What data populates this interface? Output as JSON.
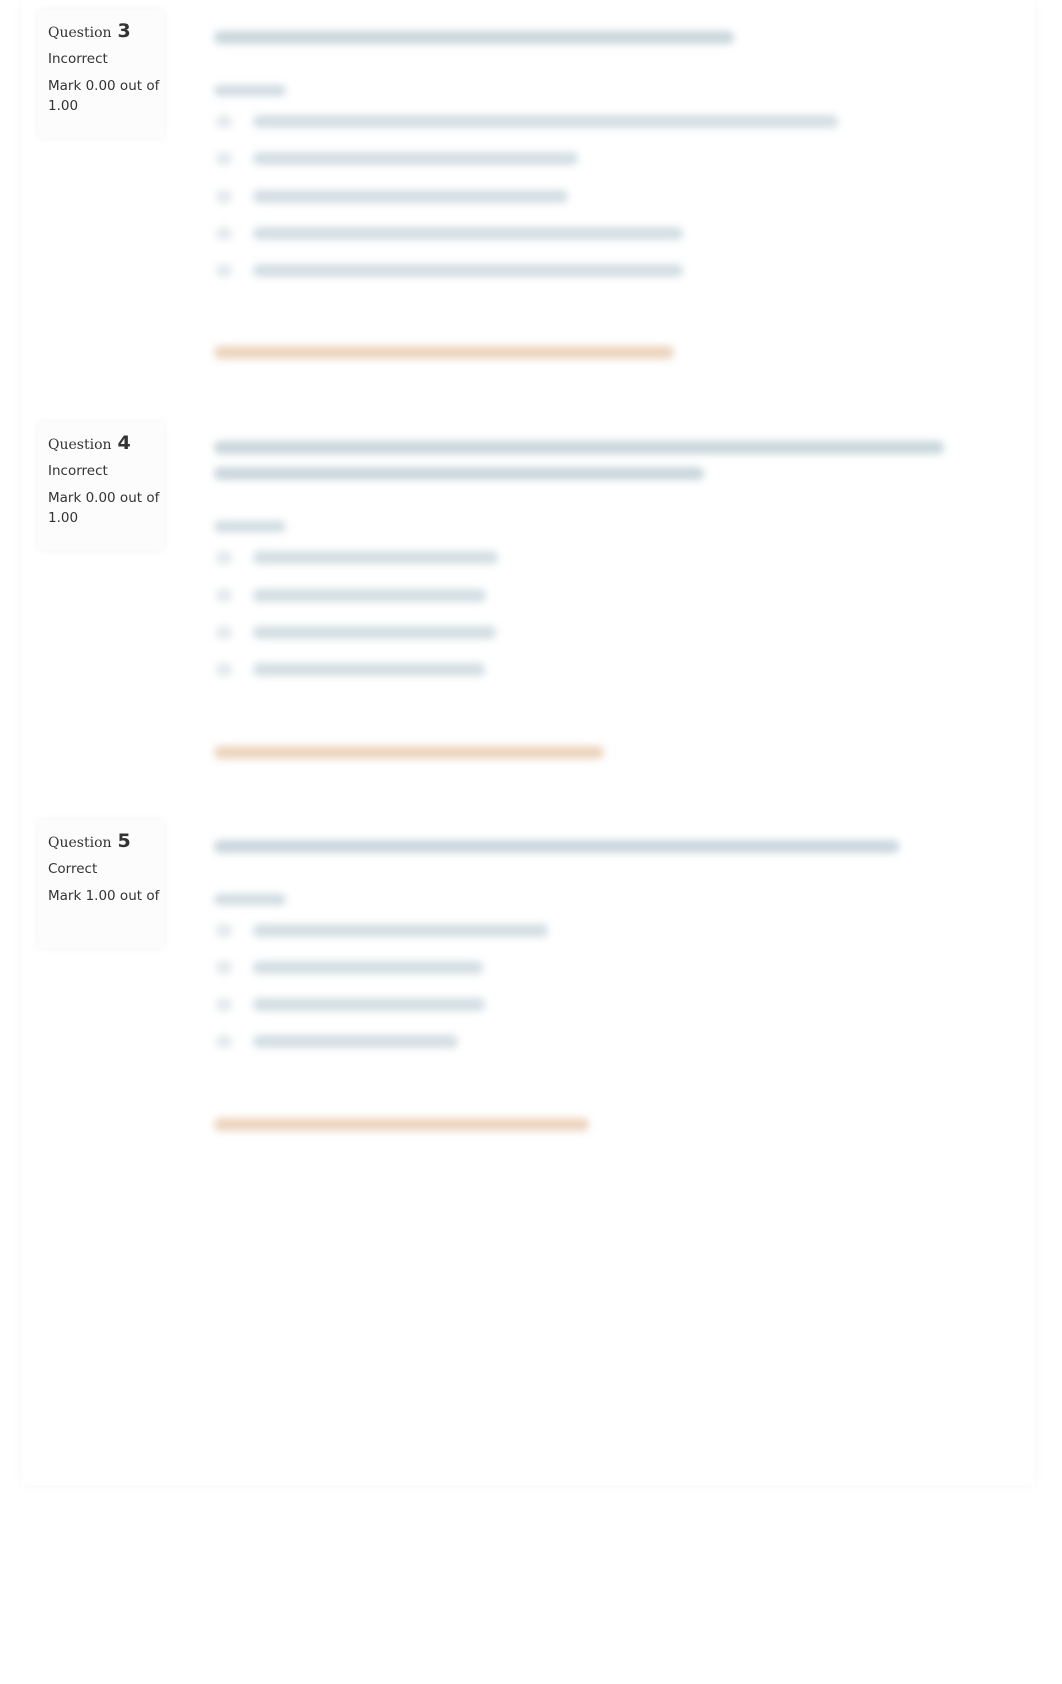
{
  "questions": [
    {
      "label": "Question",
      "number": "3",
      "state": "Incorrect",
      "mark": "Mark 0.00 out of 1.00",
      "options_count": 5
    },
    {
      "label": "Question",
      "number": "4",
      "state": "Incorrect",
      "mark": "Mark 0.00 out of 1.00",
      "options_count": 4
    },
    {
      "label": "Question",
      "number": "5",
      "state": "Correct",
      "mark": "Mark 1.00 out of",
      "options_count": 4
    }
  ],
  "colors": {
    "question_text": "#c9d6dc",
    "feedback_text": "#e8c9ae",
    "info_bg": "#fcfcfc"
  }
}
